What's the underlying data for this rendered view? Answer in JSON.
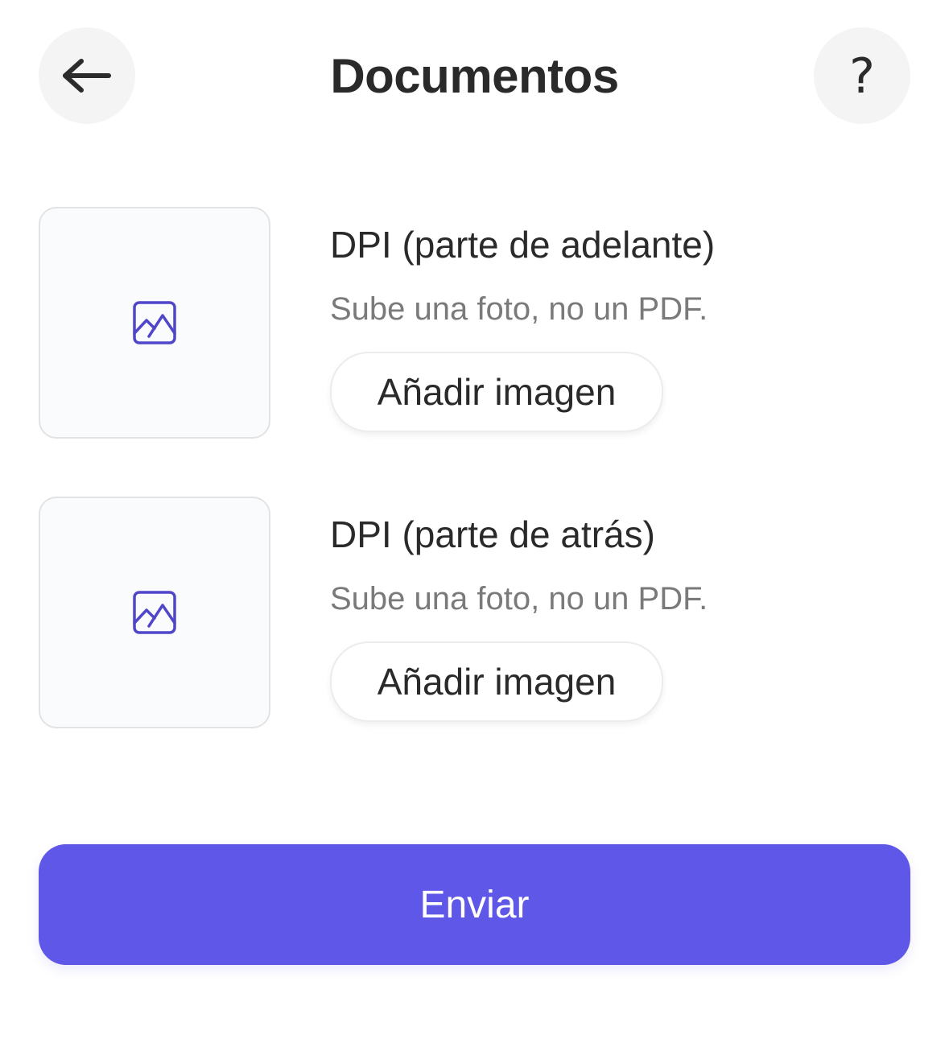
{
  "header": {
    "title": "Documentos",
    "back_icon": "arrow-left-icon",
    "help_icon": "question-mark-icon",
    "help_glyph": "?"
  },
  "documents": [
    {
      "title": "DPI (parte de adelante)",
      "subtitle": "Sube una foto, no un PDF.",
      "button_label": "Añadir imagen",
      "thumbnail_icon": "image-icon"
    },
    {
      "title": "DPI (parte de atrás)",
      "subtitle": "Sube una foto, no un PDF.",
      "button_label": "Añadir imagen",
      "thumbnail_icon": "image-icon"
    }
  ],
  "submit": {
    "label": "Enviar"
  },
  "colors": {
    "accent": "#5f57e7",
    "text_primary": "#2a2a2a",
    "text_secondary": "#7a7a7a",
    "icon_accent": "#4f46c9",
    "circle_button_bg": "#f4f4f4"
  }
}
